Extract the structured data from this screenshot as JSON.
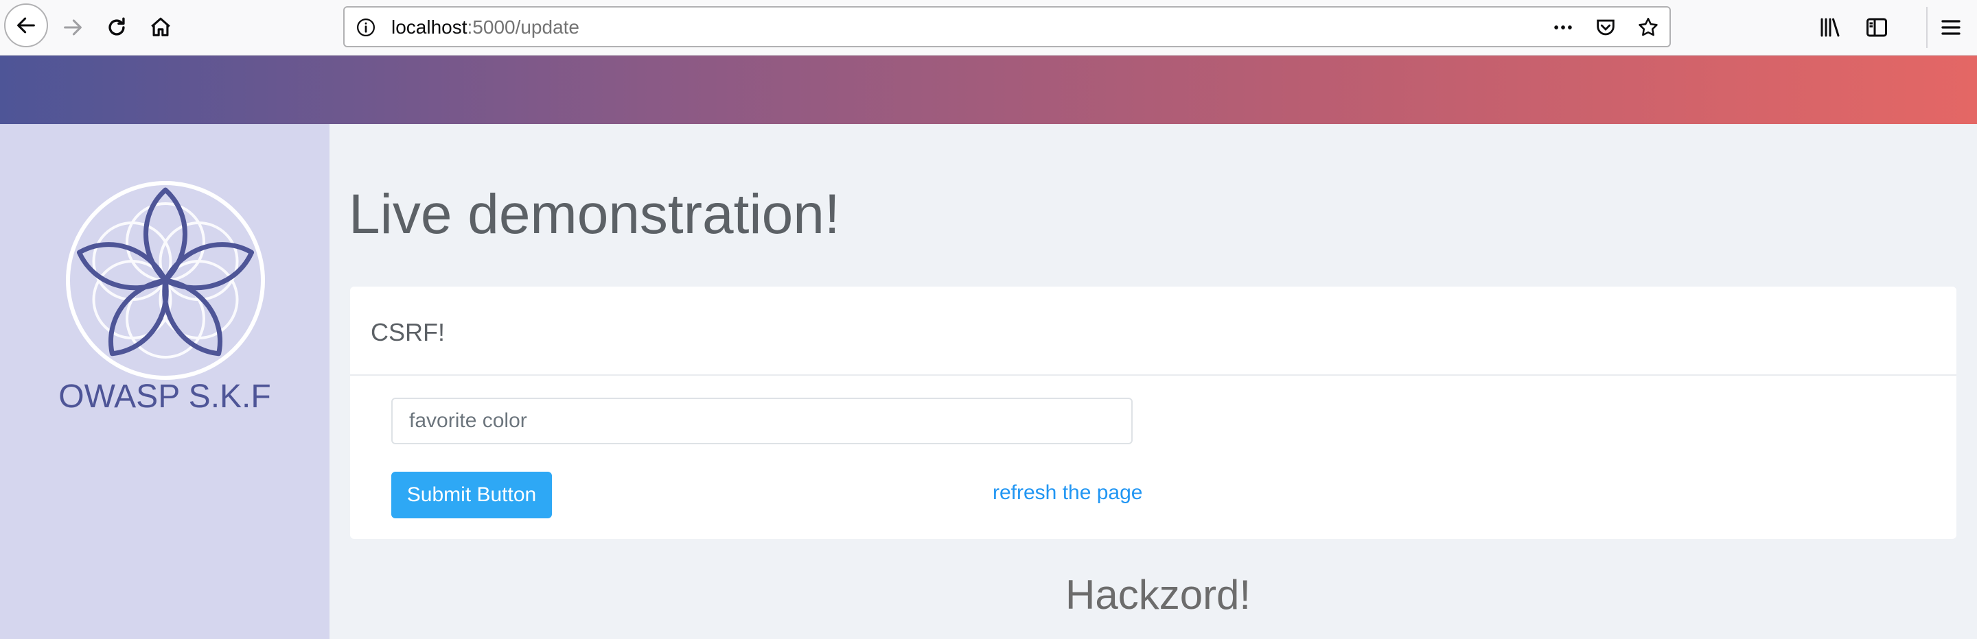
{
  "browser": {
    "url_host": "localhost",
    "url_path": ":5000/update",
    "icons": [
      "back-arrow-icon",
      "forward-arrow-icon",
      "reload-icon",
      "home-icon",
      "info-icon",
      "more-dots-icon",
      "pocket-icon",
      "bookmark-star-icon",
      "library-icon",
      "sidebar-icon",
      "hamburger-menu-icon"
    ]
  },
  "colors": {
    "gradient_start": "#4e5597",
    "gradient_end": "#e46765",
    "sidebar_bg": "#d5d6ee",
    "brand": "#4e5597",
    "primary_button": "#2ea8f5",
    "link": "#2196f3"
  },
  "sidebar": {
    "brand": "OWASP S.K.F"
  },
  "main": {
    "title": "Live demonstration!",
    "card": {
      "title": "CSRF!",
      "input_placeholder": "favorite color",
      "input_value": "",
      "submit_label": "Submit Button",
      "refresh_label": "refresh the page"
    },
    "subtitle": "Hackzord!"
  }
}
